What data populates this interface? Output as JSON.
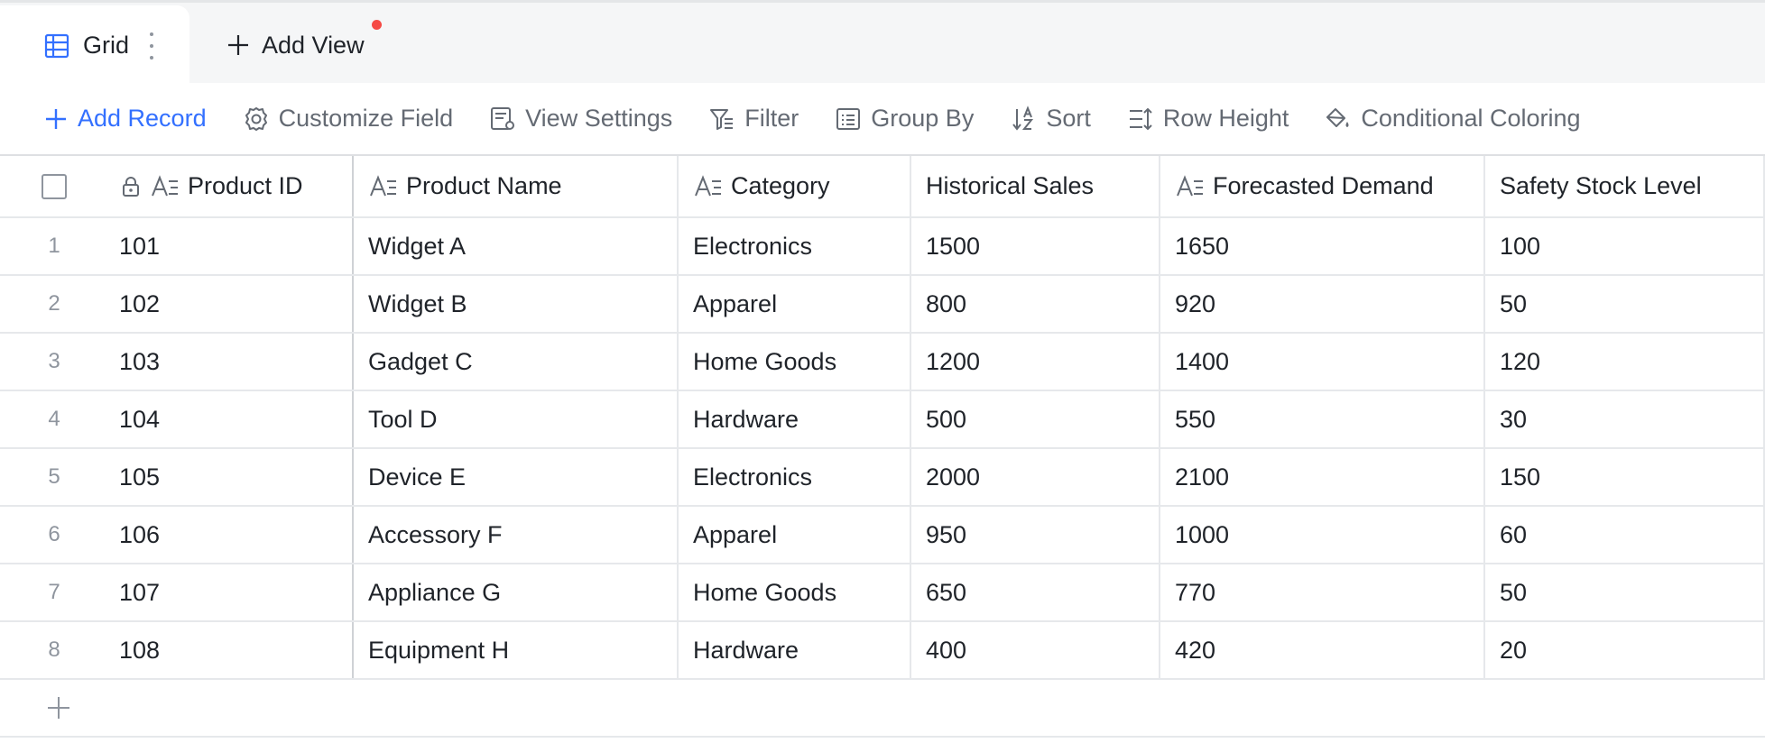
{
  "tabs": {
    "active": {
      "label": "Grid",
      "icon": "grid-table-icon"
    },
    "add_view_label": "Add View"
  },
  "toolbar": {
    "add_record": "Add Record",
    "customize_field": "Customize Field",
    "view_settings": "View Settings",
    "filter": "Filter",
    "group_by": "Group By",
    "sort": "Sort",
    "row_height": "Row Height",
    "conditional_coloring": "Conditional Coloring"
  },
  "columns": [
    "Product ID",
    "Product Name",
    "Category",
    "Historical Sales",
    "Forecasted Demand",
    "Safety Stock Level"
  ],
  "rows": [
    {
      "num": "1",
      "id": "101",
      "name": "Widget A",
      "category": "Electronics",
      "hist": "1500",
      "forecast": "1650",
      "safety": "100"
    },
    {
      "num": "2",
      "id": "102",
      "name": "Widget B",
      "category": "Apparel",
      "hist": "800",
      "forecast": "920",
      "safety": "50"
    },
    {
      "num": "3",
      "id": "103",
      "name": "Gadget C",
      "category": "Home Goods",
      "hist": "1200",
      "forecast": "1400",
      "safety": "120"
    },
    {
      "num": "4",
      "id": "104",
      "name": "Tool D",
      "category": "Hardware",
      "hist": "500",
      "forecast": "550",
      "safety": "30"
    },
    {
      "num": "5",
      "id": "105",
      "name": "Device E",
      "category": "Electronics",
      "hist": "2000",
      "forecast": "2100",
      "safety": "150"
    },
    {
      "num": "6",
      "id": "106",
      "name": "Accessory F",
      "category": "Apparel",
      "hist": "950",
      "forecast": "1000",
      "safety": "60"
    },
    {
      "num": "7",
      "id": "107",
      "name": "Appliance G",
      "category": "Home Goods",
      "hist": "650",
      "forecast": "770",
      "safety": "50"
    },
    {
      "num": "8",
      "id": "108",
      "name": "Equipment H",
      "category": "Hardware",
      "hist": "400",
      "forecast": "420",
      "safety": "20"
    }
  ],
  "colors": {
    "accent": "#3370ff",
    "notification_dot": "#f54a45",
    "icon_gray": "#646a73"
  }
}
